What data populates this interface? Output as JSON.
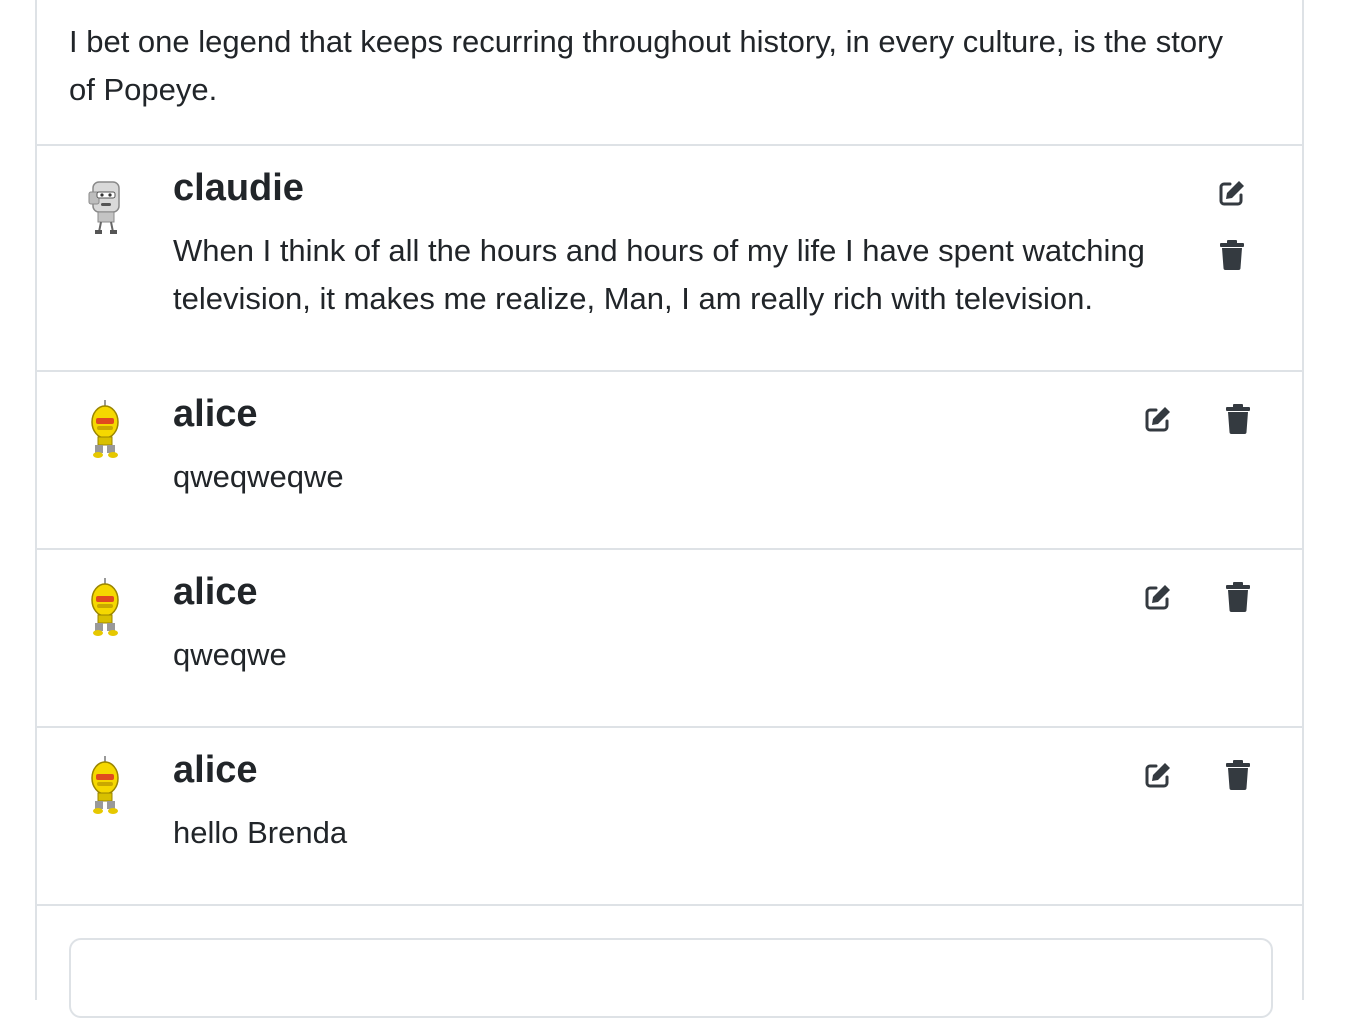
{
  "post": {
    "text": "I bet one legend that keeps recurring throughout history, in every culture, is the story of Popeye."
  },
  "comments": [
    {
      "author": "claudie",
      "text": "When I think of all the hours and hours of my life I have spent watching television, it makes me realize, Man, I am really rich with television.",
      "avatar": "gray-robot-avatar"
    },
    {
      "author": "alice",
      "text": "qweqweqwe",
      "avatar": "yellow-robot-avatar"
    },
    {
      "author": "alice",
      "text": "qweqwe",
      "avatar": "yellow-robot-avatar"
    },
    {
      "author": "alice",
      "text": "hello Brenda",
      "avatar": "yellow-robot-avatar"
    }
  ],
  "icons": {
    "edit": "edit-icon",
    "delete": "trash-icon"
  },
  "colors": {
    "icon": "#343a40",
    "border": "#dee2e6",
    "text": "#212529"
  }
}
